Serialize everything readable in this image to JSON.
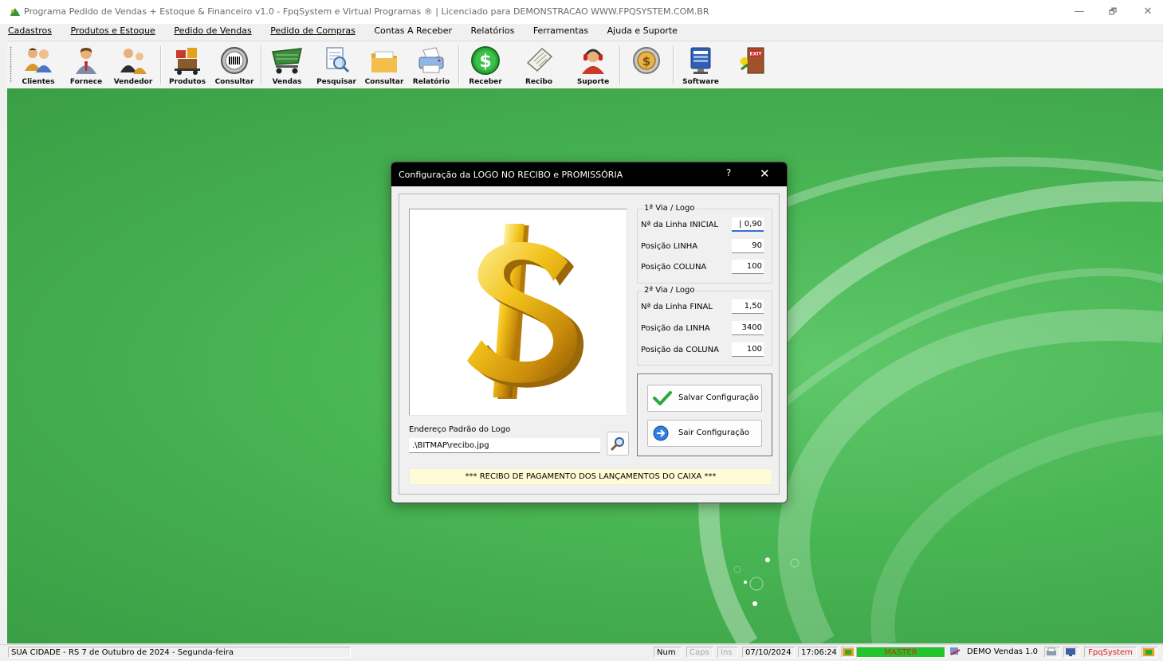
{
  "window": {
    "title": "Programa Pedido de Vendas + Estoque & Financeiro v1.0 - FpqSystem e Virtual Programas ® | Licenciado para  DEMONSTRACAO WWW.FPQSYSTEM.COM.BR",
    "minimize": "—",
    "maximize": "🗗",
    "close": "✕"
  },
  "menu": [
    {
      "label": "Cadastros",
      "underline": true
    },
    {
      "label": "Produtos e Estoque",
      "underline": true
    },
    {
      "label": "Pedido de Vendas",
      "underline": true
    },
    {
      "label": "Pedido de Compras",
      "underline": true
    },
    {
      "label": "Contas A Receber",
      "underline": false
    },
    {
      "label": "Relatórios",
      "underline": false
    },
    {
      "label": "Ferramentas",
      "underline": false
    },
    {
      "label": "Ajuda e Suporte",
      "underline": false
    }
  ],
  "toolbar": [
    {
      "label": "Clientes",
      "icon": "clients-icon"
    },
    {
      "label": "Fornece",
      "icon": "supplier-icon"
    },
    {
      "label": "Vendedor",
      "icon": "seller-icon"
    },
    {
      "label": "Produtos",
      "icon": "products-icon"
    },
    {
      "label": "Consultar",
      "icon": "barcode-icon"
    },
    {
      "label": "Vendas",
      "icon": "cart-icon"
    },
    {
      "label": "Pesquisar",
      "icon": "search-doc-icon"
    },
    {
      "label": "Consultar",
      "icon": "folder-icon"
    },
    {
      "label": "Relatório",
      "icon": "printer-icon"
    },
    {
      "label": "Receber",
      "icon": "dollar-icon"
    },
    {
      "label": "Recibo",
      "icon": "receipt-icon"
    },
    {
      "label": "Suporte",
      "icon": "support-icon"
    },
    {
      "label": "",
      "icon": "coin-icon"
    },
    {
      "label": "Software",
      "icon": "software-icon"
    },
    {
      "label": "",
      "icon": "exit-icon"
    }
  ],
  "dialog": {
    "title": "Configuração da LOGO NO RECIBO e PROMISSÓRIA",
    "help": "?",
    "close": "✕",
    "group1": {
      "legend": "1ª Via / Logo",
      "rows": [
        {
          "label": "Nª da Linha INICIAL",
          "value": "| 0,90"
        },
        {
          "label": "Posição LINHA",
          "value": "90"
        },
        {
          "label": "Posição COLUNA",
          "value": "100"
        }
      ]
    },
    "group2": {
      "legend": "2ª Via / Logo",
      "rows": [
        {
          "label": "Nª da Linha FINAL",
          "value": "1,50"
        },
        {
          "label": "Posição da LINHA",
          "value": "3400"
        },
        {
          "label": "Posição da COLUNA",
          "value": "100"
        }
      ]
    },
    "save_label": "Salvar Configuração",
    "exit_label": "Sair Configuração",
    "path_label": "Endereço Padrão do Logo",
    "path_value": ".\\BITMAP\\recibo.jpg",
    "banner": "*** RECIBO DE PAGAMENTO DOS LANÇAMENTOS DO CAIXA ***"
  },
  "status": {
    "location": "SUA CIDADE - RS  7 de Outubro de 2024 - Segunda-feira",
    "num": "Num",
    "caps": "Caps",
    "ins": "Ins",
    "date": "07/10/2024",
    "time": "17:06:24",
    "user": "MASTER",
    "version": "DEMO Vendas 1.0",
    "brand": "FpqSystem"
  },
  "colors": {
    "desktop_green": "#48b553",
    "dialog_title": "#000000",
    "banner_bg": "#fffbd6",
    "status_user_bg": "#22c52b"
  }
}
